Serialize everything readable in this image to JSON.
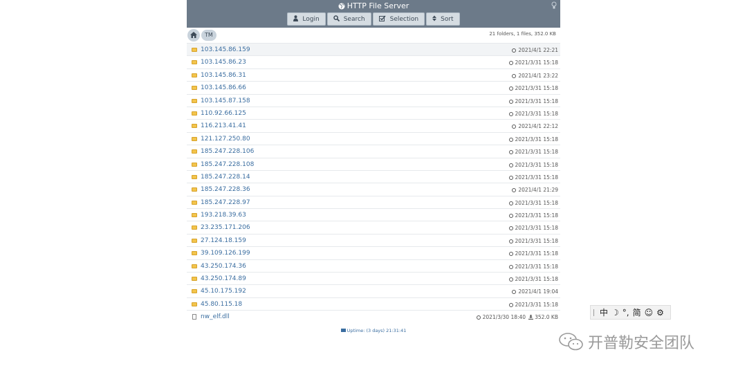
{
  "header": {
    "title": "HTTP File Server",
    "buttons": [
      {
        "label": "Login",
        "icon": "user-icon"
      },
      {
        "label": "Search",
        "icon": "search-icon"
      },
      {
        "label": "Selection",
        "icon": "checkbox-icon"
      },
      {
        "label": "Sort",
        "icon": "sort-icon"
      }
    ]
  },
  "breadcrumb": {
    "home_icon": "home-icon",
    "current": "TM",
    "summary": "21 folders, 1 files, 352.0 KB"
  },
  "files": [
    {
      "name": "103.145.86.159",
      "date": "2021/4/1 22:21"
    },
    {
      "name": "103.145.86.23",
      "date": "2021/3/31 15:18"
    },
    {
      "name": "103.145.86.31",
      "date": "2021/4/1 23:22"
    },
    {
      "name": "103.145.86.66",
      "date": "2021/3/31 15:18"
    },
    {
      "name": "103.145.87.158",
      "date": "2021/3/31 15:18"
    },
    {
      "name": "110.92.66.125",
      "date": "2021/3/31 15:18"
    },
    {
      "name": "116.213.41.41",
      "date": "2021/4/1 22:12"
    },
    {
      "name": "121.127.250.80",
      "date": "2021/3/31 15:18"
    },
    {
      "name": "185.247.228.106",
      "date": "2021/3/31 15:18"
    },
    {
      "name": "185.247.228.108",
      "date": "2021/3/31 15:18"
    },
    {
      "name": "185.247.228.14",
      "date": "2021/3/31 15:18"
    },
    {
      "name": "185.247.228.36",
      "date": "2021/4/1 21:29"
    },
    {
      "name": "185.247.228.97",
      "date": "2021/3/31 15:18"
    },
    {
      "name": "193.218.39.63",
      "date": "2021/3/31 15:18"
    },
    {
      "name": "23.235.171.206",
      "date": "2021/3/31 15:18"
    },
    {
      "name": "27.124.18.159",
      "date": "2021/3/31 15:18"
    },
    {
      "name": "39.109.126.199",
      "date": "2021/3/31 15:18"
    },
    {
      "name": "43.250.174.36",
      "date": "2021/3/31 15:18"
    },
    {
      "name": "43.250.174.89",
      "date": "2021/3/31 15:18"
    },
    {
      "name": "45.10.175.192",
      "date": "2021/4/1 19:04"
    },
    {
      "name": "45.80.115.18",
      "date": "2021/3/31 15:18"
    },
    {
      "name": "nw_elf.dll",
      "date": "2021/3/30 18:40",
      "size": "352.0 KB",
      "is_file": true
    }
  ],
  "footer": {
    "uptime": "Uptime: (3 days) 21:31:41"
  },
  "ime_toolbar": [
    "中",
    "☽",
    "°,",
    "简",
    "☺",
    "⚙"
  ],
  "watermark": {
    "text": "开普勒安全团队"
  },
  "colors": {
    "header_bg": "#6c7a89",
    "link": "#3a6da0",
    "folder": "#f3c44c"
  }
}
